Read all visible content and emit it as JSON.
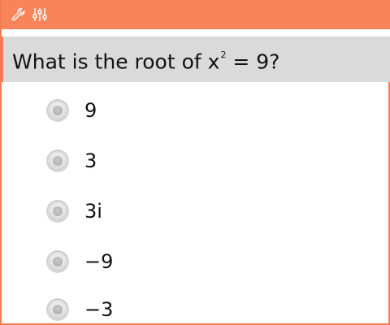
{
  "toolbar": {
    "icons": [
      "wrench-icon",
      "sliders-icon"
    ],
    "color": "#f98459"
  },
  "question": {
    "prefix": "What is the root of x",
    "exponent": "2",
    "suffix": " = 9?"
  },
  "options": [
    {
      "label": "9"
    },
    {
      "label": "3"
    },
    {
      "label": "3i"
    },
    {
      "label": "−9"
    },
    {
      "label": "−3"
    }
  ]
}
